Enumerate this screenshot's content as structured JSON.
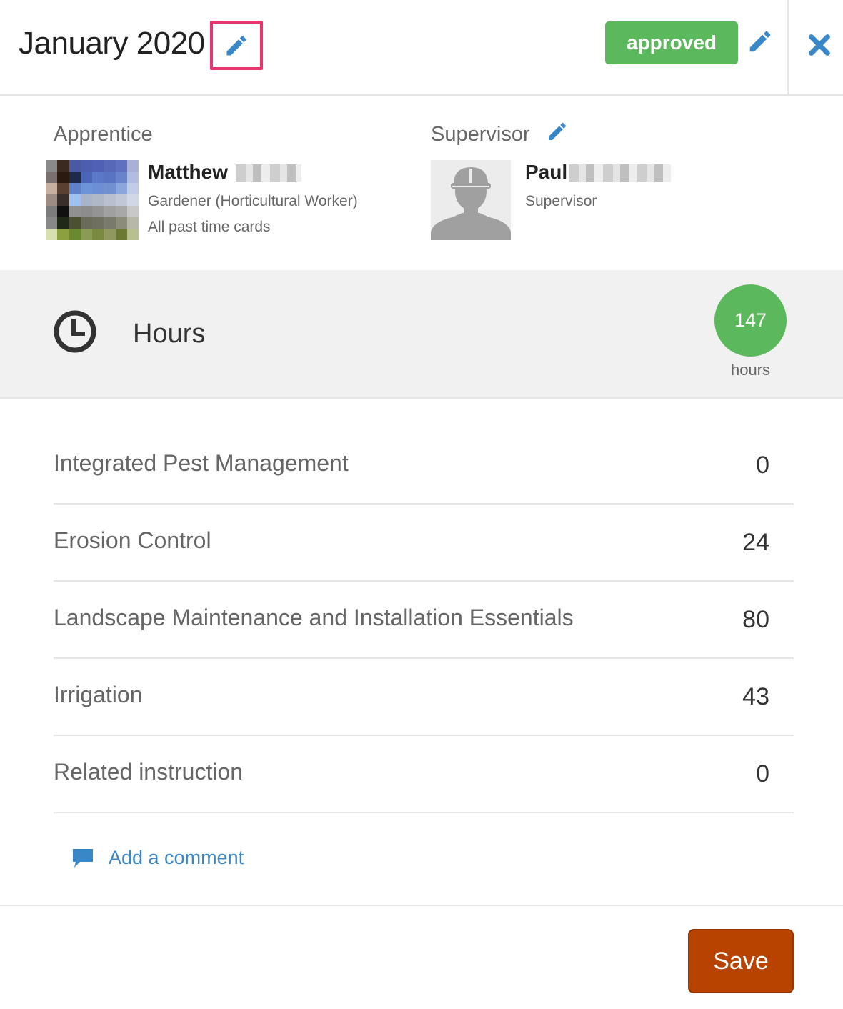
{
  "header": {
    "title": "January 2020",
    "status": "approved",
    "icons": {
      "title_edit": "pencil-icon",
      "status_edit": "pencil-icon",
      "close": "close-icon"
    }
  },
  "apprentice": {
    "label": "Apprentice",
    "first_name": "Matthew",
    "role": "Gardener (Horticultural Worker)",
    "past_cards_link": "All past time cards"
  },
  "supervisor": {
    "label": "Supervisor",
    "first_name": "Paul",
    "role": "Supervisor",
    "icons": {
      "edit": "pencil-icon",
      "avatar": "person-hardhat-icon"
    }
  },
  "hours": {
    "title": "Hours",
    "total": "147",
    "unit": "hours",
    "icon": "clock-icon"
  },
  "rows": [
    {
      "label": "Integrated Pest Management",
      "value": "0"
    },
    {
      "label": "Erosion Control",
      "value": "24"
    },
    {
      "label": "Landscape Maintenance and Installation Essentials",
      "value": "80"
    },
    {
      "label": "Irrigation",
      "value": "43"
    },
    {
      "label": "Related instruction",
      "value": "0"
    }
  ],
  "comment": {
    "label": "Add a comment",
    "icon": "comment-icon"
  },
  "footer": {
    "save_label": "Save"
  },
  "colors": {
    "accent_blue": "#3a87c8",
    "approved_green": "#5cb85c",
    "save_orange": "#b84300",
    "highlight_pink": "#e8356d"
  }
}
